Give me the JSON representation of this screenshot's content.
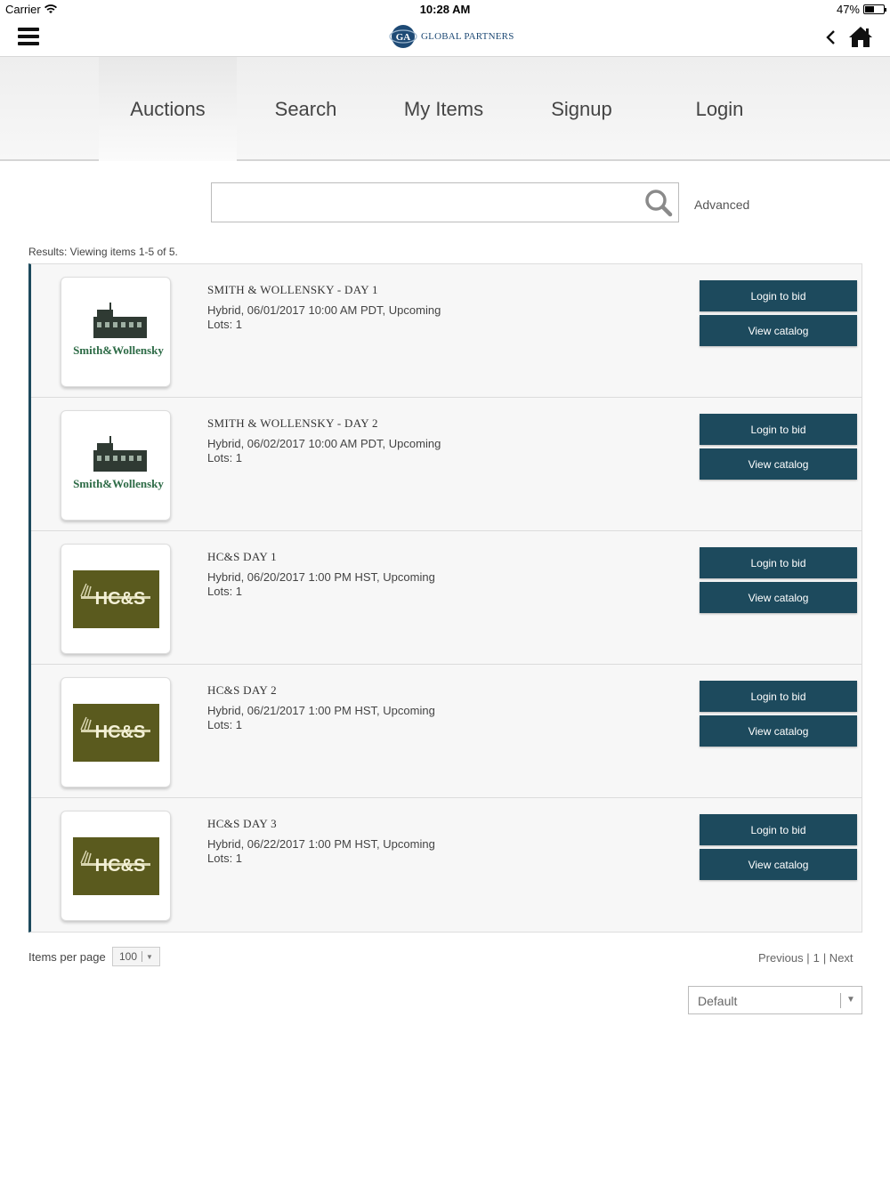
{
  "status_bar": {
    "carrier": "Carrier",
    "time": "10:28 AM",
    "battery": "47%"
  },
  "header": {
    "logo_text": "GLOBAL PARTNERS",
    "logo_badge": "GA"
  },
  "nav": {
    "tabs": [
      {
        "label": "Auctions",
        "active": true
      },
      {
        "label": "Search",
        "active": false
      },
      {
        "label": "My Items",
        "active": false
      },
      {
        "label": "Signup",
        "active": false
      },
      {
        "label": "Login",
        "active": false
      }
    ]
  },
  "search": {
    "value": "",
    "placeholder": "",
    "advanced_label": "Advanced"
  },
  "results_text": "Results: Viewing items 1-5 of 5.",
  "auctions": [
    {
      "title": "SMITH & WOLLENSKY - DAY 1",
      "meta": "Hybrid, 06/01/2017 10:00 AM PDT, Upcoming",
      "lots": "Lots: 1",
      "logo": "smith-wollensky",
      "logo_text": "Smith&Wollensky",
      "bid_label": "Login to bid",
      "catalog_label": "View catalog"
    },
    {
      "title": "SMITH & WOLLENSKY - DAY 2",
      "meta": "Hybrid, 06/02/2017 10:00 AM PDT, Upcoming",
      "lots": "Lots: 1",
      "logo": "smith-wollensky",
      "logo_text": "Smith&Wollensky",
      "bid_label": "Login to bid",
      "catalog_label": "View catalog"
    },
    {
      "title": "HC&S DAY 1",
      "meta": "Hybrid, 06/20/2017 1:00 PM HST, Upcoming",
      "lots": "Lots: 1",
      "logo": "hcs",
      "logo_text": "HC&S",
      "bid_label": "Login to bid",
      "catalog_label": "View catalog"
    },
    {
      "title": "HC&S DAY 2",
      "meta": "Hybrid, 06/21/2017 1:00 PM HST, Upcoming",
      "lots": "Lots: 1",
      "logo": "hcs",
      "logo_text": "HC&S",
      "bid_label": "Login to bid",
      "catalog_label": "View catalog"
    },
    {
      "title": "HC&S DAY 3",
      "meta": "Hybrid, 06/22/2017 1:00 PM HST, Upcoming",
      "lots": "Lots: 1",
      "logo": "hcs",
      "logo_text": "HC&S",
      "bid_label": "Login to bid",
      "catalog_label": "View catalog"
    }
  ],
  "footer": {
    "items_per_page_label": "Items per page",
    "items_per_page_value": "100",
    "pager": {
      "previous": "Previous |",
      "page": "1",
      "next": "| Next"
    },
    "sort_value": "Default"
  },
  "colors": {
    "button": "#1d4a5d",
    "accent_border": "#1d4a5d",
    "logo_blue": "#1e4a75",
    "hcs_olive": "#5a5a1e",
    "sw_green": "#2d6b46"
  }
}
